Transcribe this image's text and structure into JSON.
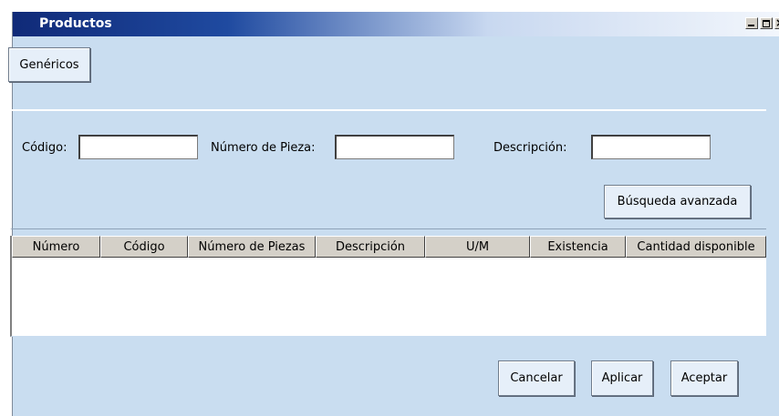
{
  "window": {
    "title": "Productos",
    "controls": [
      "minimize-icon",
      "maximize-icon",
      "close-icon"
    ],
    "colors": {
      "titlebar_start": "#102a78",
      "body": "#c9ddf0"
    }
  },
  "toolbar": {
    "genericos_label": "Genéricos"
  },
  "search": {
    "codigo_label": "Código:",
    "codigo_value": "",
    "pieza_label": "Número de Pieza:",
    "pieza_value": "",
    "descripcion_label": "Descripción:",
    "descripcion_value": "",
    "advanced_label": "Búsqueda avanzada"
  },
  "grid": {
    "columns": [
      "Número",
      "Código",
      "Número de Piezas",
      "Descripción",
      "U/M",
      "Existencia",
      "Cantidad disponible"
    ],
    "rows": []
  },
  "footer": {
    "cancel_label": "Cancelar",
    "apply_label": "Aplicar",
    "accept_label": "Aceptar"
  }
}
